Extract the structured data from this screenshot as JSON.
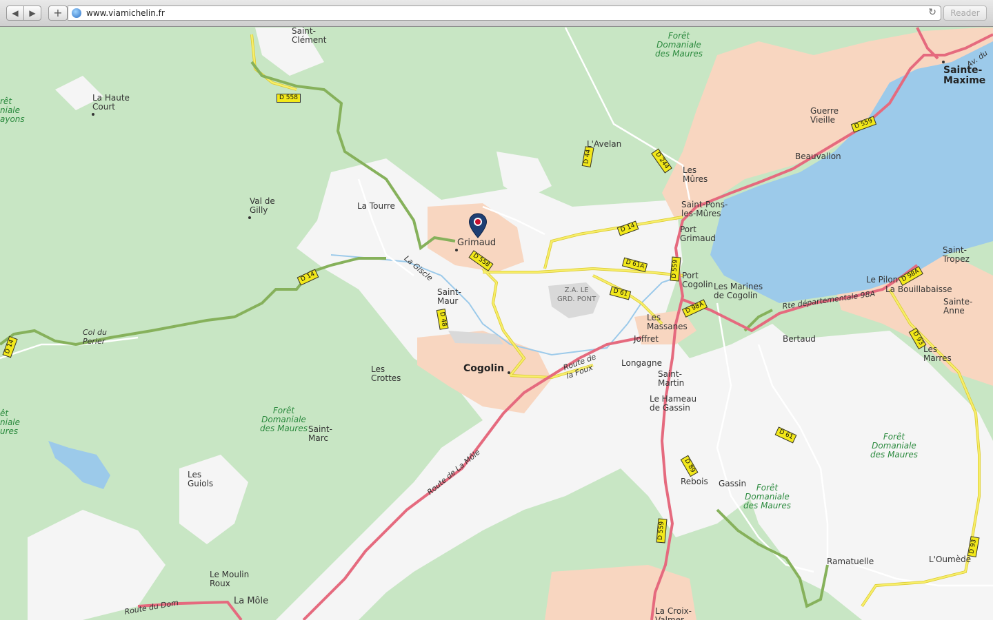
{
  "browser": {
    "url": "www.viamichelin.fr",
    "reader_label": "Reader",
    "back_icon": "◀",
    "forward_icon": "▶",
    "add_icon": "+",
    "reload_icon": "↻"
  },
  "map": {
    "colors": {
      "forest": "#c8e6c4",
      "open": "#f5f5f5",
      "urban": "#f8d6c0",
      "sea": "#9ccaea",
      "main_road": "#e56a7e",
      "secondary_road": "#f2e13c",
      "green_route": "#86b15b",
      "shield": "#f2e81a"
    },
    "places": [
      {
        "name": "Saint-\nClément",
        "kind": "place"
      },
      {
        "name": "La Haute\nCourt",
        "kind": "place"
      },
      {
        "name": "rêt\nniale\nayons",
        "kind": "forest"
      },
      {
        "name": "Val de\nGilly",
        "kind": "place"
      },
      {
        "name": "La Tourre",
        "kind": "place"
      },
      {
        "name": "L'Avelan",
        "kind": "place"
      },
      {
        "name": "Forêt\nDomaniale\ndes Maures",
        "kind": "forest"
      },
      {
        "name": "Sainte-\nMaxime",
        "kind": "town"
      },
      {
        "name": "Guerre\nVieille",
        "kind": "place"
      },
      {
        "name": "Beauvallon",
        "kind": "place"
      },
      {
        "name": "Les\nMûres",
        "kind": "place"
      },
      {
        "name": "Saint-Pons-\nles-Mûres",
        "kind": "place"
      },
      {
        "name": "Port\nGrimaud",
        "kind": "place"
      },
      {
        "name": "Grimaud",
        "kind": "place"
      },
      {
        "name": "Port\nCogolin",
        "kind": "place"
      },
      {
        "name": "Les Marines\nde Cogolin",
        "kind": "place"
      },
      {
        "name": "Saint-\nTropez",
        "kind": "place"
      },
      {
        "name": "Le Pilon",
        "kind": "place"
      },
      {
        "name": "La Bouillabaisse",
        "kind": "place"
      },
      {
        "name": "Sainte-\nAnne",
        "kind": "place"
      },
      {
        "name": "Saint-\nMaur",
        "kind": "place"
      },
      {
        "name": "Z.A. LE\nGRD. PONT",
        "kind": "zone"
      },
      {
        "name": "Col du\nPerier",
        "kind": "road"
      },
      {
        "name": "Les\nMassanes",
        "kind": "place"
      },
      {
        "name": "Joffret",
        "kind": "place"
      },
      {
        "name": "Bertaud",
        "kind": "place"
      },
      {
        "name": "Les\nMarres",
        "kind": "place"
      },
      {
        "name": "Les\nCrottes",
        "kind": "place"
      },
      {
        "name": "Cogolin",
        "kind": "town"
      },
      {
        "name": "Longagne",
        "kind": "place"
      },
      {
        "name": "Saint-\nMartin",
        "kind": "place"
      },
      {
        "name": "Le Hameau\nde Gassin",
        "kind": "place"
      },
      {
        "name": "Forêt\nDomaniale\ndes Maures",
        "kind": "forest"
      },
      {
        "name": "Saint-\nMarc",
        "kind": "place"
      },
      {
        "name": "êt\nniale\nures",
        "kind": "forest"
      },
      {
        "name": "Forêt\nDomaniale\ndes Maures",
        "kind": "forest"
      },
      {
        "name": "Les\nGuiols",
        "kind": "place"
      },
      {
        "name": "Rebois",
        "kind": "place"
      },
      {
        "name": "Gassin",
        "kind": "place"
      },
      {
        "name": "Forêt\nDomaniale\ndes Maures",
        "kind": "forest"
      },
      {
        "name": "Ramatuelle",
        "kind": "place"
      },
      {
        "name": "L'Oumède",
        "kind": "place"
      },
      {
        "name": "Le Moulin\nRoux",
        "kind": "place"
      },
      {
        "name": "La Môle",
        "kind": "place"
      },
      {
        "name": "La Croix-\nValmer",
        "kind": "place"
      }
    ],
    "road_names": [
      "La Giscle",
      "Route de\nla Foux",
      "Route de La Môle",
      "Rte départementale 98A",
      "Route du Dom",
      "Av. du"
    ],
    "shields": [
      "D 558",
      "D 44",
      "D 244",
      "D 14",
      "D 14",
      "D 558",
      "D 61A",
      "D 61",
      "D 559",
      "D 98A",
      "D 48",
      "D 14",
      "D 61",
      "D 89",
      "D 559",
      "D 98A",
      "D 93",
      "D 559",
      "D 93"
    ],
    "marker_icon": "map-pin"
  }
}
